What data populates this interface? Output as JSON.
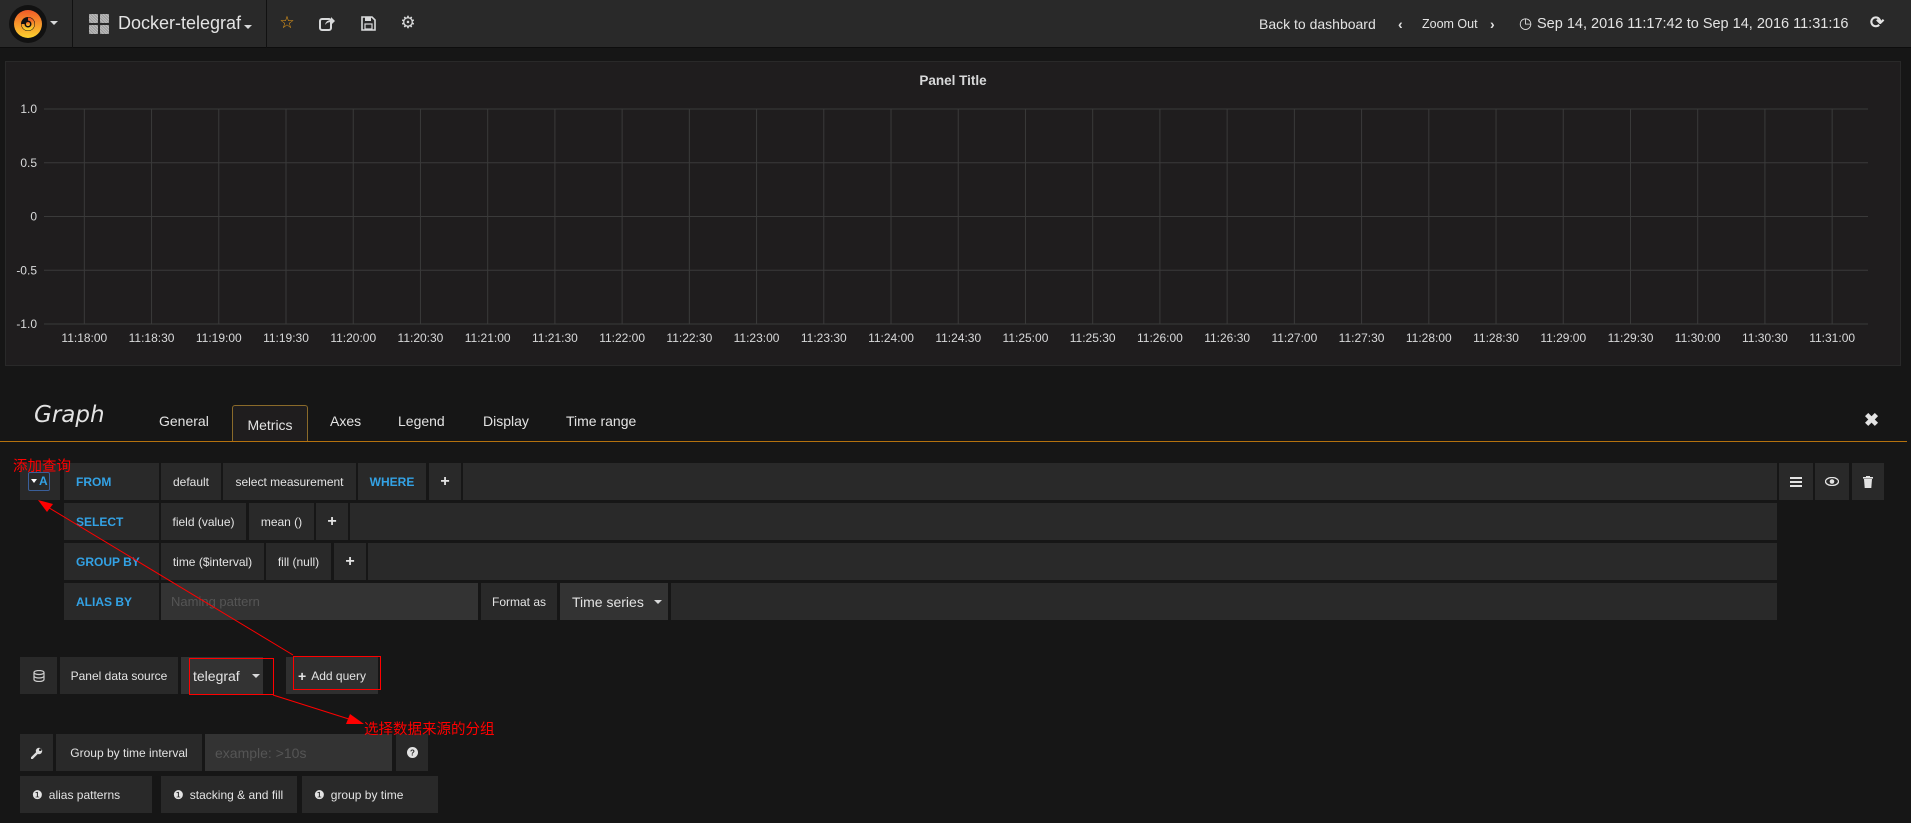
{
  "navbar": {
    "logo_icon": "grafana-logo-icon",
    "dashboard_title": "Docker-telegraf",
    "icons": [
      "star-icon",
      "share-icon",
      "save-icon",
      "gear-icon"
    ],
    "back_to_dashboard": "Back to dashboard",
    "zoom_out": "Zoom Out",
    "time_range": "Sep 14, 2016 11:17:42 to Sep 14, 2016 11:31:16",
    "refresh_icon": "refresh-icon",
    "accent_color": "#eb9d18"
  },
  "panel": {
    "title": "Panel Title"
  },
  "chart_data": {
    "type": "line",
    "title": "Panel Title",
    "xlabel": "",
    "ylabel": "",
    "series": [],
    "ylim": [
      -1.0,
      1.0
    ],
    "yticks": [
      "1.0",
      "0.5",
      "0",
      "-0.5",
      "-1.0"
    ],
    "ytick_values": [
      1.0,
      0.5,
      0,
      -0.5,
      -1.0
    ],
    "xlim": [
      "11:17:42",
      "11:31:16"
    ],
    "xticks": [
      "11:18:00",
      "11:18:30",
      "11:19:00",
      "11:19:30",
      "11:20:00",
      "11:20:30",
      "11:21:00",
      "11:21:30",
      "11:22:00",
      "11:22:30",
      "11:23:00",
      "11:23:30",
      "11:24:00",
      "11:24:30",
      "11:25:00",
      "11:25:30",
      "11:26:00",
      "11:26:30",
      "11:27:00",
      "11:27:30",
      "11:28:00",
      "11:28:30",
      "11:29:00",
      "11:29:30",
      "11:30:00",
      "11:30:30",
      "11:31:00"
    ],
    "grid": true
  },
  "editor": {
    "title": "Graph",
    "tabs": [
      {
        "label": "General",
        "active": false
      },
      {
        "label": "Metrics",
        "active": true
      },
      {
        "label": "Axes",
        "active": false
      },
      {
        "label": "Legend",
        "active": false
      },
      {
        "label": "Display",
        "active": false
      },
      {
        "label": "Time range",
        "active": false
      }
    ],
    "close_icon": "close-icon"
  },
  "query": {
    "letter": "A",
    "from": {
      "keyword": "FROM",
      "policy": "default",
      "measurement": "select measurement",
      "where": "WHERE",
      "add": "+"
    },
    "select": {
      "keyword": "SELECT",
      "field": "field (value)",
      "fn": "mean ()",
      "add": "+"
    },
    "group_by": {
      "keyword": "GROUP BY",
      "time": "time ($interval)",
      "fill": "fill (null)",
      "add": "+"
    },
    "alias_by": {
      "keyword": "ALIAS BY",
      "placeholder": "Naming pattern",
      "format_label": "Format as",
      "format_value": "Time series"
    },
    "actions": [
      "menu-icon",
      "eye-icon",
      "trash-icon"
    ]
  },
  "datasource": {
    "label": "Panel data source",
    "value": "telegraf",
    "add_query": "Add query"
  },
  "options": {
    "group_by_interval_label": "Group by time interval",
    "group_by_interval_placeholder": "example: >10s",
    "help": [
      "alias patterns",
      "stacking & and fill",
      "group by time"
    ]
  },
  "annotations": {
    "add_query_note": "添加查询",
    "datasource_note": "选择数据来源的分组",
    "color": "#ff0000"
  }
}
